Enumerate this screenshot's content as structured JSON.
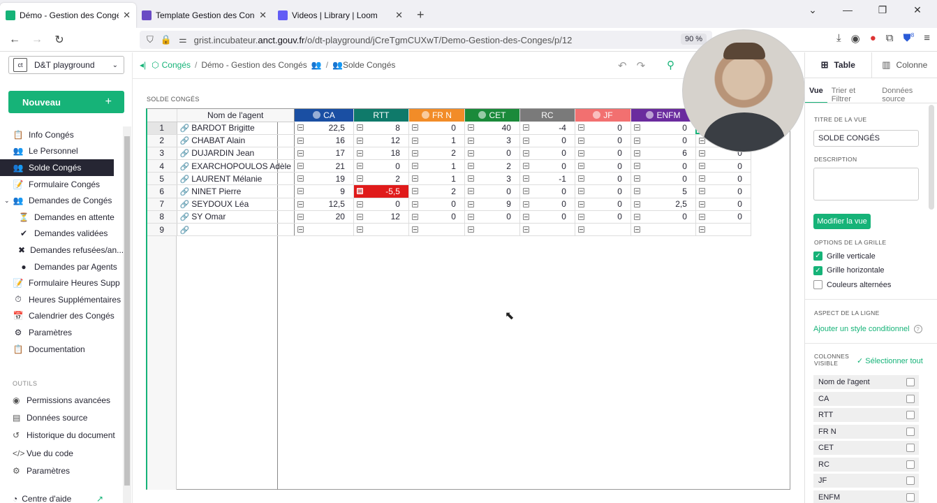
{
  "browser": {
    "tabs": [
      {
        "title": "Démo - Gestion des Congés - G",
        "color": "#16b378"
      },
      {
        "title": "Template Gestion des Congés e",
        "color": "#6a4bc4"
      },
      {
        "title": "Videos | Library | Loom",
        "color": "#625df5"
      }
    ],
    "url_prefix": "grist.incubateur.",
    "url_host": "anct.gouv.fr",
    "url_path": "/o/dt-playground/jCreTgmCUXwT/Demo-Gestion-des-Conges/p/12",
    "zoom": "90 %",
    "badge_count": "8"
  },
  "workspace": {
    "name": "D&T playground",
    "logo": "ct"
  },
  "new_button": "Nouveau",
  "pages": [
    {
      "label": "Info Congés",
      "icon": "📋"
    },
    {
      "label": "Le Personnel",
      "icon": "👥"
    },
    {
      "label": "Solde Congés",
      "icon": "👥",
      "active": true
    },
    {
      "label": "Formulaire Congés",
      "icon": "📝"
    },
    {
      "label": "Demandes de Congés",
      "icon": "👥",
      "caret": "⌄"
    },
    {
      "label": "Demandes en attente",
      "icon": "⏳",
      "sub": true
    },
    {
      "label": "Demandes validées",
      "icon": "✔",
      "sub": true
    },
    {
      "label": "Demandes refusées/an...",
      "icon": "✖",
      "sub": true
    },
    {
      "label": "Demandes par Agents",
      "icon": "●",
      "sub": true
    },
    {
      "label": "Formulaire Heures Supp",
      "icon": "📝"
    },
    {
      "label": "Heures Supplémentaires",
      "icon": "⏱"
    },
    {
      "label": "Calendrier des Congés",
      "icon": "📅"
    },
    {
      "label": "Paramètres",
      "icon": "⚙"
    },
    {
      "label": "Documentation",
      "icon": "📋"
    }
  ],
  "tools_title": "OUTILS",
  "tools": [
    {
      "label": "Permissions avancées",
      "icon": "◉"
    },
    {
      "label": "Données source",
      "icon": "▤"
    },
    {
      "label": "Historique du document",
      "icon": "↺"
    },
    {
      "label": "Vue du code",
      "icon": "</>"
    },
    {
      "label": "Paramètres",
      "icon": "⚙"
    }
  ],
  "help": "Centre d'aide",
  "breadcrumb": {
    "doc_folder": "Congés",
    "doc": "Démo - Gestion des Congés",
    "page": "Solde Congés"
  },
  "section_title": "SOLDE CONGÉS",
  "grid": {
    "name_header": "Nom de l'agent",
    "columns": [
      {
        "label": "CA",
        "color": "#1a4fa3",
        "info": true
      },
      {
        "label": "RTT",
        "color": "#0f7a6a",
        "info": false
      },
      {
        "label": "FR N",
        "color": "#f28c28",
        "info": true
      },
      {
        "label": "CET",
        "color": "#1a8a3a",
        "info": true
      },
      {
        "label": "RC",
        "color": "#7a7a7a",
        "info": false
      },
      {
        "label": "JF",
        "color": "#f27070",
        "info": true
      },
      {
        "label": "ENFM",
        "color": "#6a2b9e",
        "info": true
      },
      {
        "label": "",
        "color": "#444444",
        "info": false
      }
    ],
    "rows": [
      {
        "n": "1",
        "name": "BARDOT  Brigitte",
        "vals": [
          "22,5",
          "8",
          "0",
          "40",
          "-4",
          "0",
          "0",
          ""
        ]
      },
      {
        "n": "2",
        "name": "CHABAT Alain",
        "vals": [
          "16",
          "12",
          "1",
          "3",
          "0",
          "0",
          "0",
          "0"
        ]
      },
      {
        "n": "3",
        "name": "DUJARDIN Jean",
        "vals": [
          "17",
          "18",
          "2",
          "0",
          "0",
          "0",
          "6",
          "0"
        ]
      },
      {
        "n": "4",
        "name": "EXARCHOPOULOS Adèle",
        "vals": [
          "21",
          "0",
          "1",
          "2",
          "0",
          "0",
          "0",
          "0"
        ]
      },
      {
        "n": "5",
        "name": "LAURENT Mélanie",
        "vals": [
          "19",
          "2",
          "1",
          "3",
          "-1",
          "0",
          "0",
          "0"
        ]
      },
      {
        "n": "6",
        "name": "NINET Pierre",
        "vals": [
          "9",
          "-5,5",
          "2",
          "0",
          "0",
          "0",
          "5",
          "0"
        ]
      },
      {
        "n": "7",
        "name": "SEYDOUX Léa",
        "vals": [
          "12,5",
          "0",
          "0",
          "9",
          "0",
          "0",
          "2,5",
          "0"
        ]
      },
      {
        "n": "8",
        "name": "SY Omar",
        "vals": [
          "20",
          "12",
          "0",
          "0",
          "0",
          "0",
          "0",
          "0"
        ]
      },
      {
        "n": "9",
        "name": "",
        "vals": [
          "",
          "",
          "",
          "",
          "",
          "",
          "",
          ""
        ]
      }
    ],
    "negative_color": "#e01b1b"
  },
  "right_panel": {
    "tab_table": "Table",
    "tab_column": "Colonne",
    "subtabs": [
      "Vue",
      "Trier et Filtrer",
      "Données source"
    ],
    "title_label": "TITRE DE LA VUE",
    "title_value": "SOLDE CONGÉS",
    "desc_label": "DESCRIPTION",
    "modify_button": "Modifier la vue",
    "grid_options_label": "OPTIONS DE LA GRILLE",
    "options": [
      {
        "label": "Grille verticale",
        "checked": true
      },
      {
        "label": "Grille horizontale",
        "checked": true
      },
      {
        "label": "Couleurs alternées",
        "checked": false
      }
    ],
    "row_aspect_label": "ASPECT DE LA LIGNE",
    "conditional_link": "Ajouter un style conditionnel",
    "visible_cols_label": "COLONNES VISIBLE",
    "select_all": "✓ Sélectionner tout",
    "visible_cols": [
      "Nom de l'agent",
      "CA",
      "RTT",
      "FR N",
      "CET",
      "RC",
      "JF",
      "ENFM"
    ]
  }
}
